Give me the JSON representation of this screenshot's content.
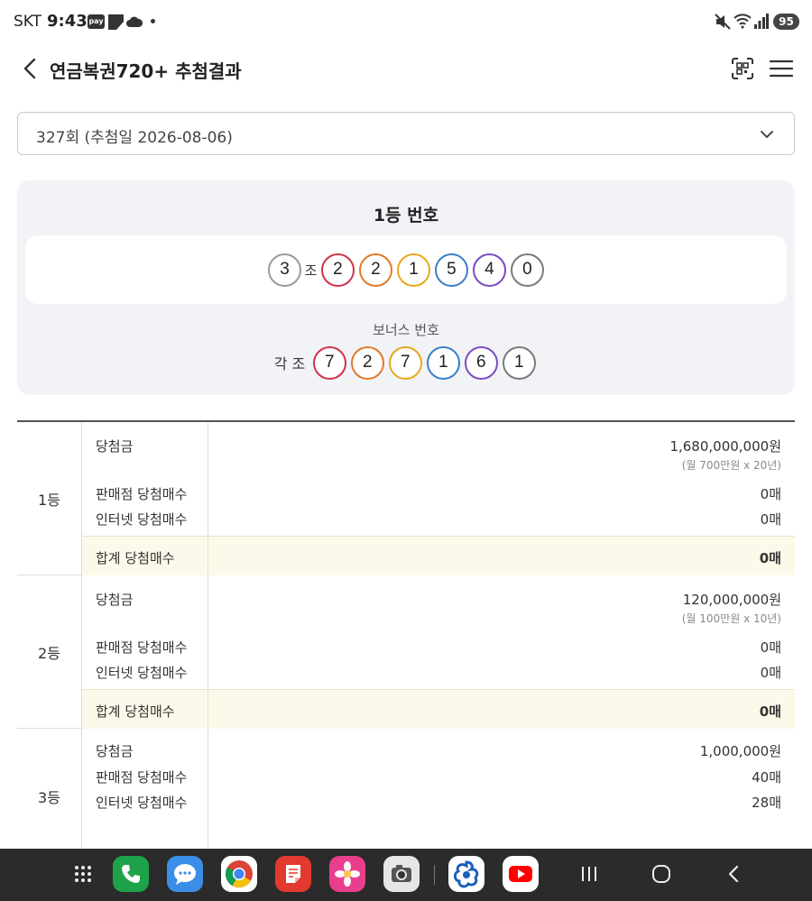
{
  "status_bar": {
    "carrier": "SKT",
    "time": "9:43",
    "pay_badge": "pay",
    "battery": "95"
  },
  "header": {
    "title": "연금복권720+ 추첨결과"
  },
  "round_select": {
    "value": "327회 (추첨일 2026-08-06)"
  },
  "winning": {
    "title": "1등 번호",
    "group": "3",
    "group_suffix": "조",
    "numbers": [
      "2",
      "2",
      "1",
      "5",
      "4",
      "0"
    ],
    "bonus_title": "보너스 번호",
    "bonus_prefix": "각 조",
    "bonus_numbers": [
      "7",
      "2",
      "7",
      "1",
      "6",
      "1"
    ]
  },
  "colors": {
    "group_ball": "#9a9a9a",
    "ball_1": "#d0334a",
    "ball_2": "#e07a2b",
    "ball_3": "#e8a81e",
    "ball_4": "#3b7fc8",
    "ball_5": "#7b4bc3",
    "ball_6": "#7a7a7a",
    "bonus_last": "#7a7a7a"
  },
  "prizes": [
    {
      "rank": "1등",
      "prize_label": "당첨금",
      "prize_amount": "1,680,000,000원",
      "prize_note": "(월 700만원 x 20년)",
      "store_label": "판매점 당첨매수",
      "store_count": "0매",
      "internet_label": "인터넷 당첨매수",
      "internet_count": "0매",
      "total_label": "합계 당첨매수",
      "total_count": "0매"
    },
    {
      "rank": "2등",
      "prize_label": "당첨금",
      "prize_amount": "120,000,000원",
      "prize_note": "(월 100만원 x 10년)",
      "store_label": "판매점 당첨매수",
      "store_count": "0매",
      "internet_label": "인터넷 당첨매수",
      "internet_count": "0매",
      "total_label": "합계 당첨매수",
      "total_count": "0매"
    },
    {
      "rank": "3등",
      "prize_label": "당첨금",
      "prize_amount": "1,000,000원",
      "store_label": "판매점 당첨매수",
      "store_count": "40매",
      "internet_label": "인터넷 당첨매수",
      "internet_count": "28매"
    }
  ],
  "nav": {
    "apps": [
      "app-drawer-icon",
      "phone-icon",
      "messages-icon",
      "chrome-icon",
      "notes-icon",
      "gallery-icon",
      "camera-icon",
      "lottery-app-icon",
      "youtube-icon"
    ],
    "buttons": [
      "recent-apps-icon",
      "home-icon",
      "back-nav-icon"
    ]
  }
}
